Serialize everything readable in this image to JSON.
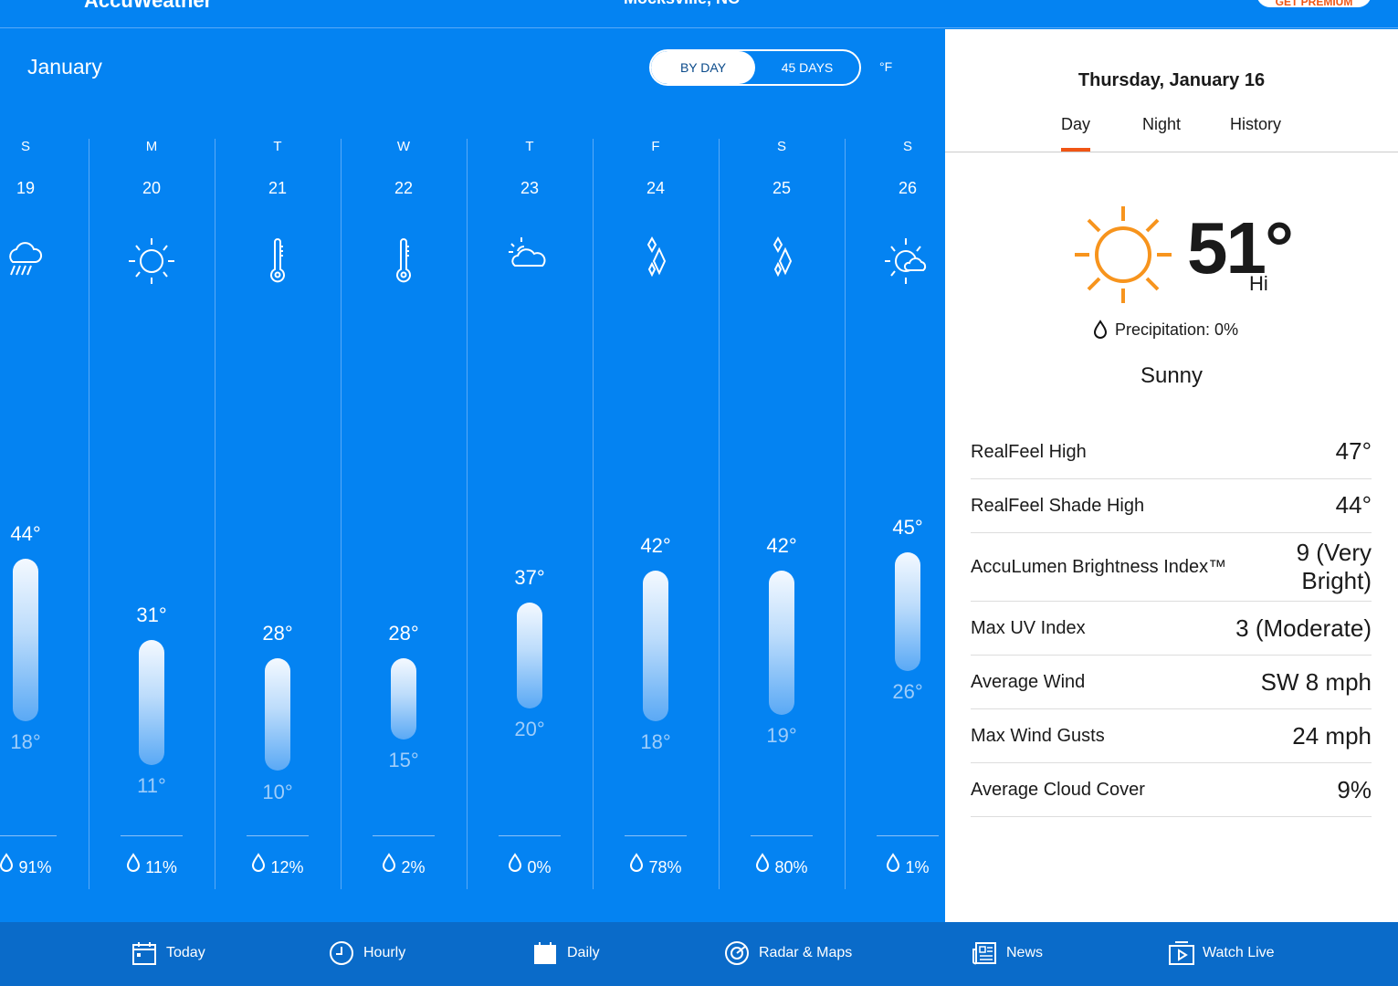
{
  "header": {
    "app_name": "AccuWeather",
    "location": "Mocksville, NC",
    "premium_button": "GET PREMIUM"
  },
  "calendar": {
    "month": "January",
    "toggle": {
      "by_day": "BY DAY",
      "days45": "45 DAYS",
      "selected": "BY DAY"
    },
    "unit": "°F",
    "days": [
      {
        "dow": "S",
        "date": "19",
        "icon": "rain-cloud-icon",
        "hi": 44,
        "lo": 18,
        "hi_label": "44°",
        "lo_label": "18°",
        "precip": "91%"
      },
      {
        "dow": "M",
        "date": "20",
        "icon": "sun-icon",
        "hi": 31,
        "lo": 11,
        "hi_label": "31°",
        "lo_label": "11°",
        "precip": "11%"
      },
      {
        "dow": "T",
        "date": "21",
        "icon": "thermometer-icon",
        "hi": 28,
        "lo": 10,
        "hi_label": "28°",
        "lo_label": "10°",
        "precip": "12%"
      },
      {
        "dow": "W",
        "date": "22",
        "icon": "thermometer-icon",
        "hi": 28,
        "lo": 15,
        "hi_label": "28°",
        "lo_label": "15°",
        "precip": "2%"
      },
      {
        "dow": "T",
        "date": "23",
        "icon": "partly-cloudy-icon",
        "hi": 37,
        "lo": 20,
        "hi_label": "37°",
        "lo_label": "20°",
        "precip": "0%"
      },
      {
        "dow": "F",
        "date": "24",
        "icon": "ice-icon",
        "hi": 42,
        "lo": 18,
        "hi_label": "42°",
        "lo_label": "18°",
        "precip": "78%"
      },
      {
        "dow": "S",
        "date": "25",
        "icon": "ice-icon",
        "hi": 42,
        "lo": 19,
        "hi_label": "42°",
        "lo_label": "19°",
        "precip": "80%"
      },
      {
        "dow": "S",
        "date": "26",
        "icon": "mostly-sunny-icon",
        "hi": 45,
        "lo": 26,
        "hi_label": "45°",
        "lo_label": "26°",
        "precip": "1%"
      }
    ]
  },
  "detail": {
    "date": "Thursday, January 16",
    "tabs": [
      "Day",
      "Night",
      "History"
    ],
    "active_tab": "Day",
    "temp": "51°",
    "temp_label": "Hi",
    "precipitation": "Precipitation: 0%",
    "condition": "Sunny",
    "sun_color": "#f7941d",
    "rows": [
      {
        "label": "RealFeel High",
        "value": "47°"
      },
      {
        "label": "RealFeel Shade High",
        "value": "44°"
      },
      {
        "label": "AccuLumen Brightness Index™",
        "value": "9 (Very Bright)"
      },
      {
        "label": "Max UV Index",
        "value": "3 (Moderate)"
      },
      {
        "label": "Average Wind",
        "value": "SW 8 mph"
      },
      {
        "label": "Max Wind Gusts",
        "value": "24 mph"
      },
      {
        "label": "Average Cloud Cover",
        "value": "9%"
      }
    ]
  },
  "nav": [
    {
      "label": "Today",
      "icon": "calendar-today-icon"
    },
    {
      "label": "Hourly",
      "icon": "clock-icon"
    },
    {
      "label": "Daily",
      "icon": "calendar-icon"
    },
    {
      "label": "Radar & Maps",
      "icon": "radar-icon"
    },
    {
      "label": "News",
      "icon": "news-icon"
    },
    {
      "label": "Watch Live",
      "icon": "play-icon"
    }
  ],
  "colors": {
    "primary": "#0483f2",
    "nav": "#0a6bc9",
    "accent": "#f05514"
  }
}
